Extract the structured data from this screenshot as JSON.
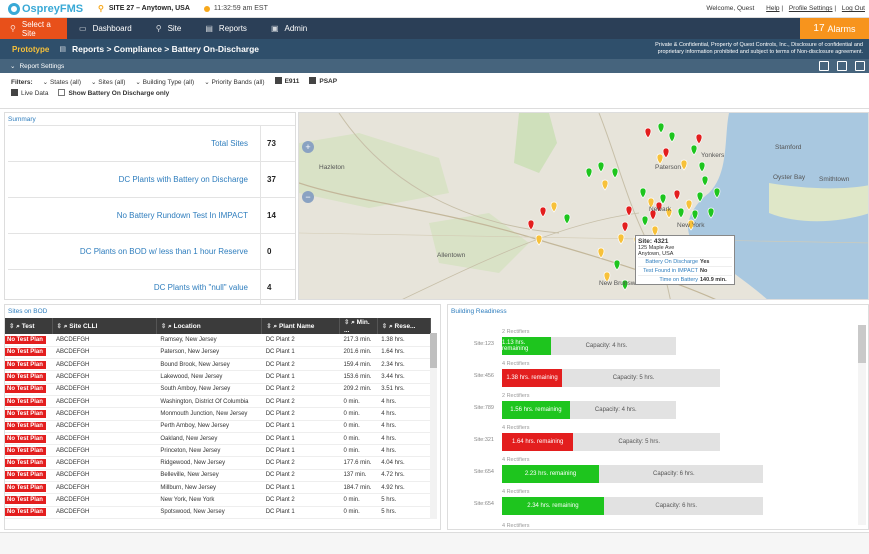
{
  "app": {
    "name": "OspreyFMS",
    "site": "SITE 27 – Anytown, USA",
    "time": "11:32:59 am EST"
  },
  "user": {
    "welcome": "Welcome, Quest",
    "links": [
      "Help",
      "Profile Settings",
      "Log Out"
    ]
  },
  "nav": {
    "items": [
      "Select a Site",
      "Dashboard",
      "Site",
      "Reports",
      "Admin"
    ],
    "alarms_count": "17",
    "alarms_label": "Alarms"
  },
  "crumb": {
    "prototype": "Prototype",
    "path": "Reports > Compliance > Battery On-Discharge",
    "confidential": "Private & Confidential, Property of Quest Controls, Inc., Disclosure of confidential and proprietary information prohibited and subject to terms of Non-disclosure agreement."
  },
  "settings": {
    "label": "Report Settings"
  },
  "filters": {
    "label": "Filters:",
    "dropdowns": [
      "States (all)",
      "Sites (all)",
      "Building Type (all)",
      "Priority Bands (all)"
    ],
    "checks": [
      "E911",
      "PSAP"
    ],
    "live_data": "Live Data",
    "show_battery": "Show Battery On Discharge only"
  },
  "summary": {
    "title": "Summary",
    "rows": [
      {
        "k": "Total Sites",
        "v": "73"
      },
      {
        "k": "DC Plants with Battery on Discharge",
        "v": "37"
      },
      {
        "k": "No Battery Rundown Test In IMPACT",
        "v": "14"
      },
      {
        "k": "DC Plants on BOD w/ less than 1 hour Reserve",
        "v": "0"
      },
      {
        "k": "DC Plants with \"null\" value",
        "v": "4"
      }
    ]
  },
  "map": {
    "places": [
      "Stamford",
      "Oyster Bay",
      "Smithtown",
      "Paterson",
      "Yonkers",
      "Hazleton",
      "Allentown",
      "Newark",
      "New York",
      "New Brunswick"
    ],
    "tooltip": {
      "site": "Site: 4321",
      "addr1": "125 Maple Ave",
      "addr2": "Anytown, USA",
      "rows": [
        {
          "k": "Battery On Discharge",
          "v": "Yes"
        },
        {
          "k": "Test Found in IMPACT",
          "v": "No"
        },
        {
          "k": "Time on Battery",
          "v": "140.9 min."
        }
      ]
    }
  },
  "bod": {
    "title": "Sites on BOD",
    "headers": [
      "Test",
      "Site CLLI",
      "Location",
      "Plant Name",
      "Min. ...",
      "Rese..."
    ],
    "rows": [
      [
        "No Test Plan",
        "ABCDEFGH",
        "Ramsey, New Jersey",
        "DC Plant 2",
        "217.3 min.",
        "1.38 hrs."
      ],
      [
        "No Test Plan",
        "ABCDEFGH",
        "Paterson, New Jersey",
        "DC Plant 1",
        "201.6 min.",
        "1.64 hrs."
      ],
      [
        "No Test Plan",
        "ABCDEFGH",
        "Bound Brook, New Jersey",
        "DC Plant 2",
        "159.4 min.",
        "2.34 hrs."
      ],
      [
        "No Test Plan",
        "ABCDEFGH",
        "Lakewood, New Jersey",
        "DC Plant 1",
        "153.6 min.",
        "3.44 hrs."
      ],
      [
        "No Test Plan",
        "ABCDEFGH",
        "South Amboy, New Jersey",
        "DC Plant 2",
        "209.2 min.",
        "3.51 hrs."
      ],
      [
        "No Test Plan",
        "ABCDEFGH",
        "Washington, District Of Columbia",
        "DC Plant 2",
        "0 min.",
        "4 hrs."
      ],
      [
        "No Test Plan",
        "ABCDEFGH",
        "Monmouth Junction, New Jersey",
        "DC Plant 2",
        "0 min.",
        "4 hrs."
      ],
      [
        "No Test Plan",
        "ABCDEFGH",
        "Perth Amboy, New Jersey",
        "DC Plant 1",
        "0 min.",
        "4 hrs."
      ],
      [
        "No Test Plan",
        "ABCDEFGH",
        "Oakland, New Jersey",
        "DC Plant 1",
        "0 min.",
        "4 hrs."
      ],
      [
        "No Test Plan",
        "ABCDEFGH",
        "Princeton, New Jersey",
        "DC Plant 1",
        "0 min.",
        "4 hrs."
      ],
      [
        "No Test Plan",
        "ABCDEFGH",
        "Ridgewood, New Jersey",
        "DC Plant 2",
        "177.6 min.",
        "4.04 hrs."
      ],
      [
        "No Test Plan",
        "ABCDEFGH",
        "Belleville, New Jersey",
        "DC Plant 2",
        "137 min.",
        "4.72 hrs."
      ],
      [
        "No Test Plan",
        "ABCDEFGH",
        "Millburn, New Jersey",
        "DC Plant 1",
        "184.7 min.",
        "4.92 hrs."
      ],
      [
        "No Test Plan",
        "ABCDEFGH",
        "New York, New York",
        "DC Plant 2",
        "0 min.",
        "5 hrs."
      ],
      [
        "No Test Plan",
        "ABCDEFGH",
        "Spotswood, New Jersey",
        "DC Plant 1",
        "0 min.",
        "5 hrs."
      ]
    ]
  },
  "readiness": {
    "title": "Building Readiness",
    "items": [
      {
        "site": "Site:123",
        "rect": "2 Rectifiers",
        "remaining": "1.13 hrs. remaining",
        "remaining_hrs": 1.13,
        "capacity": "Capacity: 4 hrs.",
        "capacity_hrs": 4,
        "color": "#1ec51e"
      },
      {
        "site": "Site:456",
        "rect": "4 Rectifiers",
        "remaining": "1.38 hrs. remaining",
        "remaining_hrs": 1.38,
        "capacity": "Capacity: 5 hrs.",
        "capacity_hrs": 5,
        "color": "#e31e1e"
      },
      {
        "site": "Site:789",
        "rect": "2 Rectifiers",
        "remaining": "1.56 hrs. remaining",
        "remaining_hrs": 1.56,
        "capacity": "Capacity: 4 hrs.",
        "capacity_hrs": 4,
        "color": "#1ec51e"
      },
      {
        "site": "Site:321",
        "rect": "4 Rectifiers",
        "remaining": "1.64 hrs. remaining",
        "remaining_hrs": 1.64,
        "capacity": "Capacity: 5 hrs.",
        "capacity_hrs": 5,
        "color": "#e31e1e"
      },
      {
        "site": "Site:654",
        "rect": "4 Rectifiers",
        "remaining": "2.23 hrs. remaining",
        "remaining_hrs": 2.23,
        "capacity": "Capacity: 6 hrs.",
        "capacity_hrs": 6,
        "color": "#1ec51e"
      },
      {
        "site": "Site:654",
        "rect": "4 Rectifiers",
        "remaining": "2.34 hrs. remaining",
        "remaining_hrs": 2.34,
        "capacity": "Capacity: 6 hrs.",
        "capacity_hrs": 6,
        "color": "#1ec51e"
      }
    ],
    "partial_rect": "4 Rectifiers"
  },
  "colors": {
    "nav": "#2b3f57",
    "select": "#e8501a",
    "alarms": "#f7941d",
    "link": "#2e7dbd",
    "red": "#e31e1e",
    "green": "#1ec51e"
  }
}
